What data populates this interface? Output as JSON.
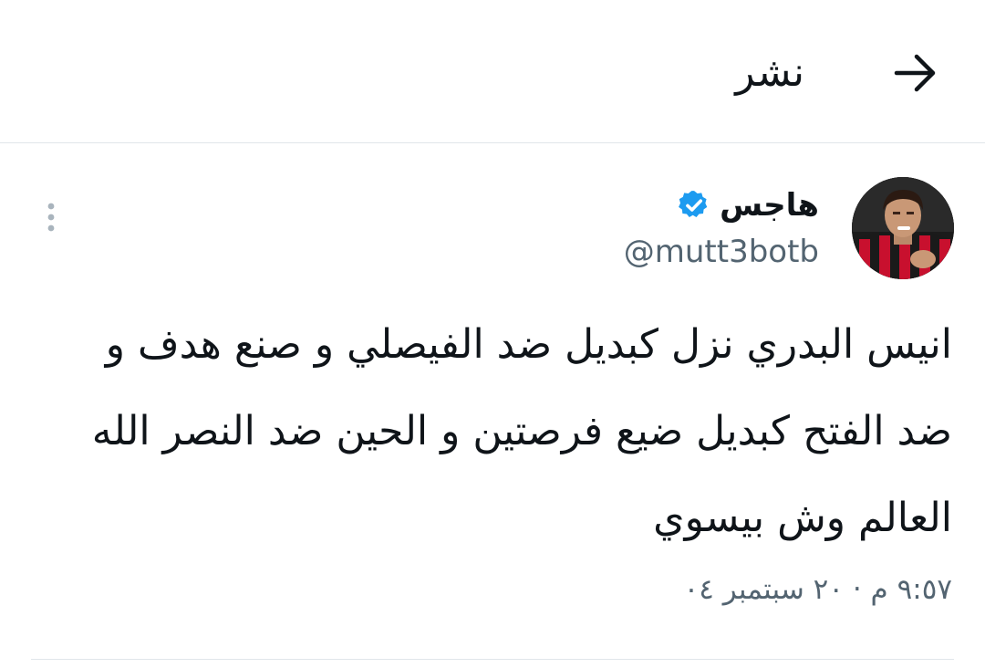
{
  "header": {
    "title": "نشر",
    "back_icon": "arrow-right-icon"
  },
  "tweet": {
    "author": {
      "display_name": "هاجس",
      "handle": "@mutt3botb",
      "verified": true,
      "verified_color": "#1d9bf0"
    },
    "text": "انيس البدري نزل كبديل ضد الفيصلي و صنع هدف و ضد الفتح كبديل ضيع فرصتين و الحين ضد النصر الله العالم وش بيسوي",
    "timestamp": "٩:٥٧ م · ٢٠ سبتمبر ٠٤"
  },
  "colors": {
    "text_primary": "#0f1419",
    "text_secondary": "#536471",
    "divider": "#e1e6ea",
    "accent": "#1d9bf0"
  }
}
